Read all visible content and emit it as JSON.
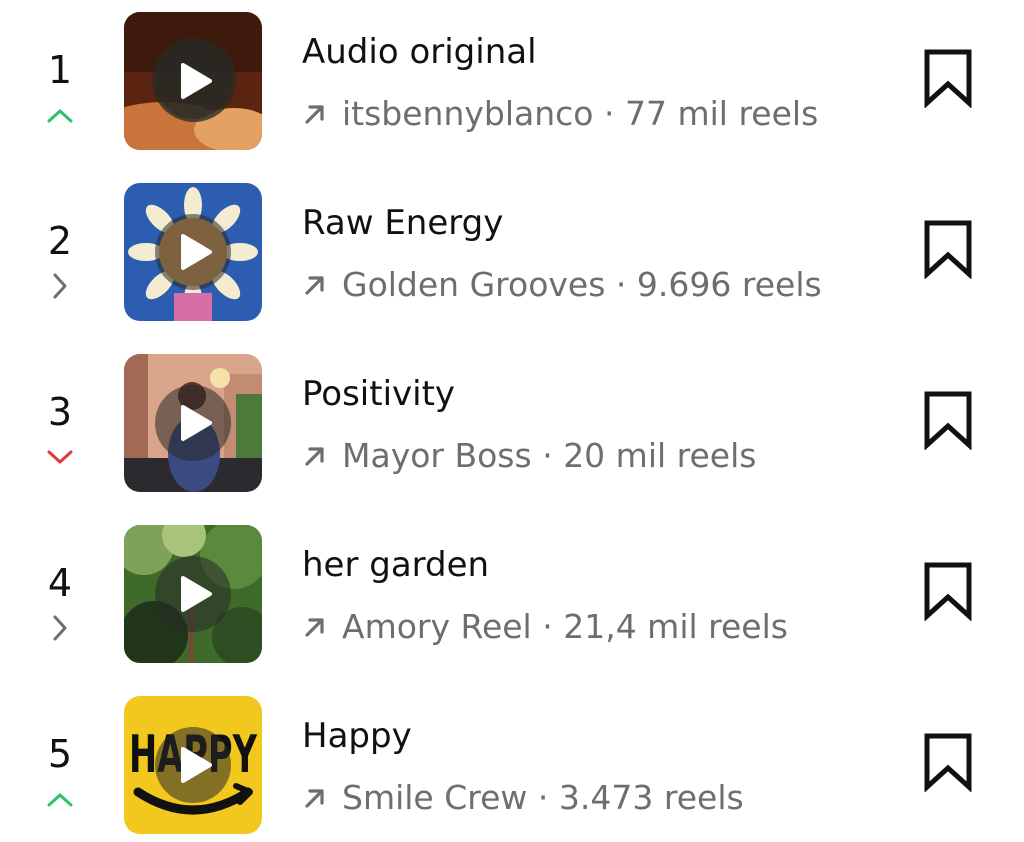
{
  "items": [
    {
      "rank": "1",
      "trend": "up",
      "title": "Audio original",
      "artist": "itsbennyblanco",
      "separator": "·",
      "count": "77 mil reels",
      "thumb_colors": [
        "#6a2a12",
        "#c8743a",
        "#2a2a22"
      ]
    },
    {
      "rank": "2",
      "trend": "same",
      "title": "Raw Energy",
      "artist": "Golden Grooves",
      "separator": "·",
      "count": "9.696 reels",
      "thumb_colors": [
        "#2c5db0",
        "#f3ecd0",
        "#e6a65a"
      ]
    },
    {
      "rank": "3",
      "trend": "down",
      "title": "Positivity",
      "artist": "Mayor Boss",
      "separator": "·",
      "count": "20 mil reels",
      "thumb_colors": [
        "#d9a58a",
        "#3b4b82",
        "#4d7a3a"
      ]
    },
    {
      "rank": "4",
      "trend": "same",
      "title": "her garden",
      "artist": "Amory Reel",
      "separator": "·",
      "count": "21,4 mil reels",
      "thumb_colors": [
        "#3f6b2a",
        "#7fa25a",
        "#20351a"
      ]
    },
    {
      "rank": "5",
      "trend": "up",
      "title": "Happy",
      "artist": "Smile Crew",
      "separator": "·",
      "count": "3.473 reels",
      "thumb_colors": [
        "#f2c81f",
        "#111111",
        "#f2c81f"
      ],
      "thumb_text": "HAPPY"
    }
  ],
  "colors": {
    "trend_up": "#2ec26a",
    "trend_down": "#e5383b",
    "trend_same": "#6e6e6e",
    "text_primary": "#111111",
    "text_secondary": "#6e6e6e"
  }
}
